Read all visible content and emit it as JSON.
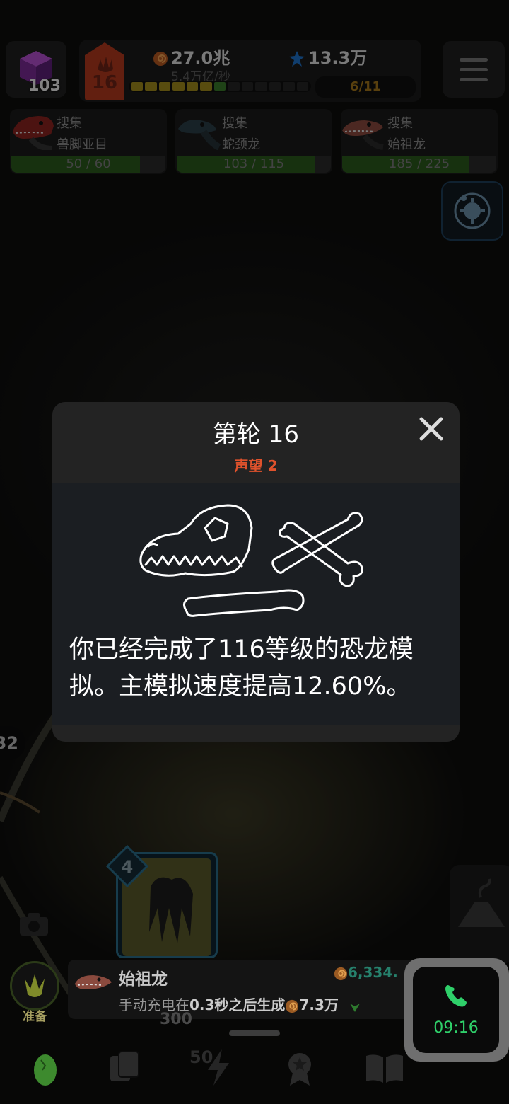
{
  "top_bar": {
    "cube_count": "103",
    "level": "16",
    "currency_amount": "27.0兆",
    "currency_rate": "5.4万亿/秒",
    "gem_amount": "13.3万",
    "stage_progress": "6/11",
    "progress_filled": 7,
    "progress_total": 13
  },
  "collect_cards": [
    {
      "label": "搜集",
      "name": "兽脚亚目",
      "progress": "50 / 60",
      "fraction": 0.833
    },
    {
      "label": "搜集",
      "name": "蛇颈龙",
      "progress": "103 / 115",
      "fraction": 0.896
    },
    {
      "label": "搜集",
      "name": "始祖龙",
      "progress": "185 / 225",
      "fraction": 0.822
    }
  ],
  "modal": {
    "title": "第轮 16",
    "subtitle": "声望 2",
    "message": "你已经完成了116等级的恐龙模拟。主模拟速度提高12.60%。"
  },
  "scene": {
    "side_number": "32",
    "card_level": "4",
    "card_label": "利爪"
  },
  "ready_button": {
    "label": "准备"
  },
  "info_bar": {
    "name": "始祖龙",
    "money": "6,334.",
    "line_prefix": "手动充电在",
    "line_time": "0.3秒之后生成",
    "line_amount": "7.3万",
    "under_value": "300"
  },
  "call_widget": {
    "time": "09:16"
  },
  "bottom_nav": {
    "energy_count": "50"
  },
  "colors": {
    "accent_red": "#e0522c",
    "collect_bar": "#2b5a1d",
    "call_green": "#2fd06a",
    "stage_gold": "#a3761a"
  }
}
